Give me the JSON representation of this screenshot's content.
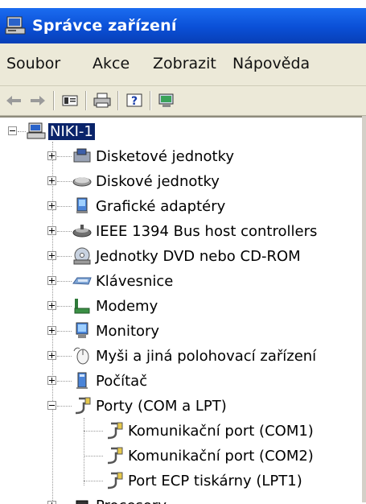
{
  "window": {
    "title": "Správce zařízení"
  },
  "menu": [
    "Soubor",
    "Akce",
    "Zobrazit",
    "Nápověda"
  ],
  "toolbar": [
    {
      "name": "back-arrow-icon"
    },
    {
      "name": "forward-arrow-icon"
    },
    {
      "name": "properties-icon"
    },
    {
      "name": "printer-icon"
    },
    {
      "name": "help-icon"
    },
    {
      "name": "scan-hardware-icon"
    }
  ],
  "tree": {
    "root": "NIKI-1",
    "categories": [
      {
        "label": "Disketové jednotky",
        "icon": "floppy-drive-icon"
      },
      {
        "label": "Diskové jednotky",
        "icon": "hard-disk-icon"
      },
      {
        "label": "Grafické adaptéry",
        "icon": "display-adapter-icon"
      },
      {
        "label": "IEEE 1394 Bus host controllers",
        "icon": "firewire-controller-icon"
      },
      {
        "label": "Jednotky DVD nebo CD-ROM",
        "icon": "cd-drive-icon"
      },
      {
        "label": "Klávesnice",
        "icon": "keyboard-icon"
      },
      {
        "label": "Modemy",
        "icon": "modem-icon"
      },
      {
        "label": "Monitory",
        "icon": "monitor-icon"
      },
      {
        "label": "Myši a jiná polohovací zařízení",
        "icon": "mouse-icon"
      },
      {
        "label": "Počítač",
        "icon": "computer-icon"
      },
      {
        "label": "Porty (COM a LPT)",
        "icon": "port-icon"
      }
    ],
    "ports": [
      {
        "label": "Komunikační port (COM1)",
        "icon": "port-icon"
      },
      {
        "label": "Komunikační port (COM2)",
        "icon": "port-icon"
      },
      {
        "label": "Port ECP tiskárny (LPT1)",
        "icon": "port-icon"
      }
    ],
    "last_partial": "Procesory"
  }
}
